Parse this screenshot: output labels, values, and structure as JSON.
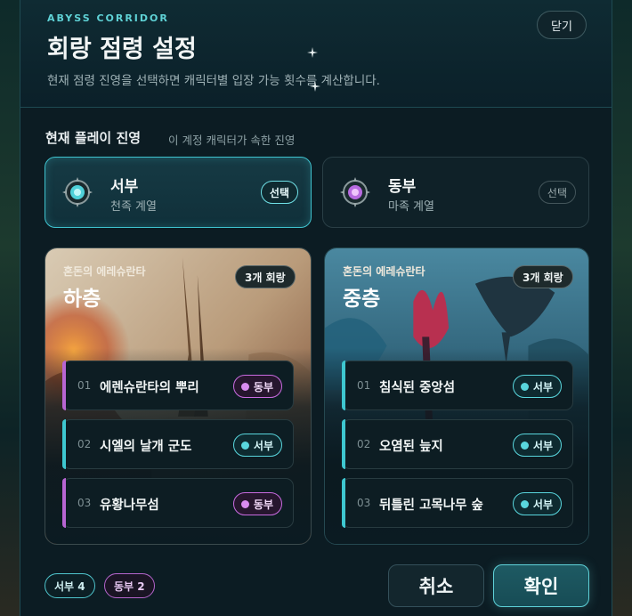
{
  "header": {
    "eyebrow": "ABYSS CORRIDOR",
    "title": "회랑 점령 설정",
    "subtitle": "현재 점령 진영을 선택하면 캐릭터별 입장 가능 횟수를 계산합니다.",
    "close_label": "닫기"
  },
  "faction_section": {
    "label": "현재 플레이 진영",
    "hint": "이 계정 캐릭터가 속한 진영"
  },
  "factions": [
    {
      "name": "서부",
      "sub": "천족 계열",
      "button": "선택",
      "selected": true,
      "color": "#4fd0d8"
    },
    {
      "name": "동부",
      "sub": "마족 계열",
      "button": "선택",
      "selected": false,
      "color": "#b86be0"
    }
  ],
  "floors": [
    {
      "eyebrow": "혼돈의 에레슈란타",
      "title": "하층",
      "count": "3개 회랑",
      "corridors": [
        {
          "num": "01",
          "name": "에렌슈란타의 뿌리",
          "owner": "동부"
        },
        {
          "num": "02",
          "name": "시엘의 날개 군도",
          "owner": "서부"
        },
        {
          "num": "03",
          "name": "유황나무섬",
          "owner": "동부"
        }
      ]
    },
    {
      "eyebrow": "혼돈의 에레슈란타",
      "title": "중층",
      "count": "3개 회랑",
      "corridors": [
        {
          "num": "01",
          "name": "침식된 중앙섬",
          "owner": "서부"
        },
        {
          "num": "02",
          "name": "오염된 늪지",
          "owner": "서부"
        },
        {
          "num": "03",
          "name": "뒤틀린 고목나무 숲",
          "owner": "서부"
        }
      ]
    }
  ],
  "footer": {
    "west_count": "서부 4",
    "east_count": "동부 2",
    "cancel_label": "취소",
    "confirm_label": "확인"
  },
  "colors": {
    "accent_west": "#4fd0d8",
    "accent_east": "#c96be0",
    "background": "#0c1c23"
  }
}
